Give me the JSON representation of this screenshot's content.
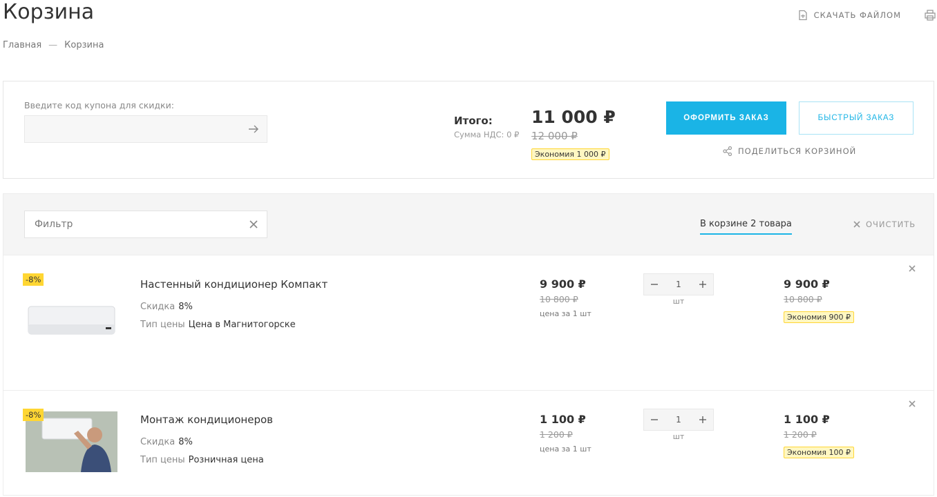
{
  "header": {
    "title": "Корзина",
    "breadcrumb": [
      "Главная",
      "—",
      "Корзина"
    ],
    "download_label": "Скачать файлом"
  },
  "summary": {
    "coupon_label": "Введите код купона для скидки:",
    "coupon_value": "",
    "total_label": "Итого:",
    "vat_label": "Сумма НДС: 0 ₽",
    "total_price": "11 000 ₽",
    "old_total": "12 000 ₽",
    "economy": "Экономия 1 000 ₽",
    "checkout_label": "Оформить заказ",
    "quick_order_label": "Быстрый заказ",
    "share_label": "Поделиться корзиной"
  },
  "filter": {
    "placeholder": "Фильтр",
    "in_cart": "В корзине 2 товара",
    "clear_label": "Очистить"
  },
  "items": [
    {
      "discount_badge": "-8%",
      "name": "Настенный кондиционер Компакт",
      "discount_label": "Скидка",
      "discount_value": "8%",
      "price_type_label": "Тип цены",
      "price_type_value": "Цена в Магнитогорске",
      "price": "9 900 ₽",
      "old_price": "10 800 ₽",
      "per_unit": "цена за 1 шт",
      "quantity": "1",
      "unit": "шт",
      "sum": "9 900 ₽",
      "old_sum": "10 800 ₽",
      "economy": "Экономия 900 ₽"
    },
    {
      "discount_badge": "-8%",
      "name": "Монтаж кондиционеров",
      "discount_label": "Скидка",
      "discount_value": "8%",
      "price_type_label": "Тип цены",
      "price_type_value": "Розничная цена",
      "price": "1 100 ₽",
      "old_price": "1 200 ₽",
      "per_unit": "цена за 1 шт",
      "quantity": "1",
      "unit": "шт",
      "sum": "1 100 ₽",
      "old_sum": "1 200 ₽",
      "economy": "Экономия 100 ₽"
    }
  ],
  "colors": {
    "accent": "#1ab4e6",
    "badge_bg": "#fff7c2",
    "badge_border": "#ffd633",
    "discount_badge": "#ffd633"
  },
  "icons": [
    "file-download-icon",
    "print-icon",
    "arrow-right-icon",
    "share-icon",
    "close-icon",
    "minus-icon",
    "plus-icon"
  ]
}
